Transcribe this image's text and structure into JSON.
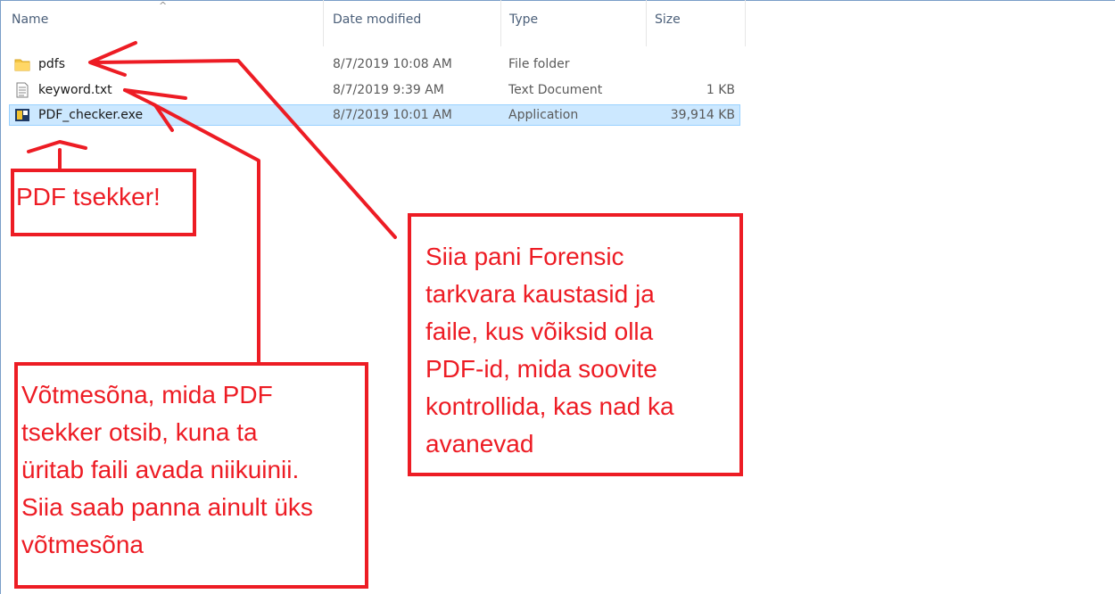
{
  "explorer": {
    "columns": {
      "name": "Name",
      "date_modified": "Date modified",
      "type": "Type",
      "size": "Size"
    },
    "sort_indicator": "^",
    "files": [
      {
        "name": "pdfs",
        "date": "8/7/2019 10:08 AM",
        "type": "File folder",
        "size": "",
        "icon": "folder-icon",
        "selected": false
      },
      {
        "name": "keyword.txt",
        "date": "8/7/2019 9:39 AM",
        "type": "Text Document",
        "size": "1 KB",
        "icon": "text-document-icon",
        "selected": false
      },
      {
        "name": "PDF_checker.exe",
        "date": "8/7/2019 10:01 AM",
        "type": "Application",
        "size": "39,914 KB",
        "icon": "application-icon",
        "selected": true
      }
    ]
  },
  "annotations": {
    "color": "#ed1c24",
    "pdf_checker_note": "PDF tsekker!",
    "keyword_note": "Võtmesõna, mida PDF\ntsekker otsib, kuna ta\nüritab faili avada niikuinii.\nSiia saab panna ainult üks\nvõtmesõna",
    "pdfs_note": "Siia pani Forensic\ntarkvara kaustasid ja\nfaile, kus võiksid olla\nPDF-id, mida soovite\nkontrollida, kas nad ka\navanevad"
  }
}
